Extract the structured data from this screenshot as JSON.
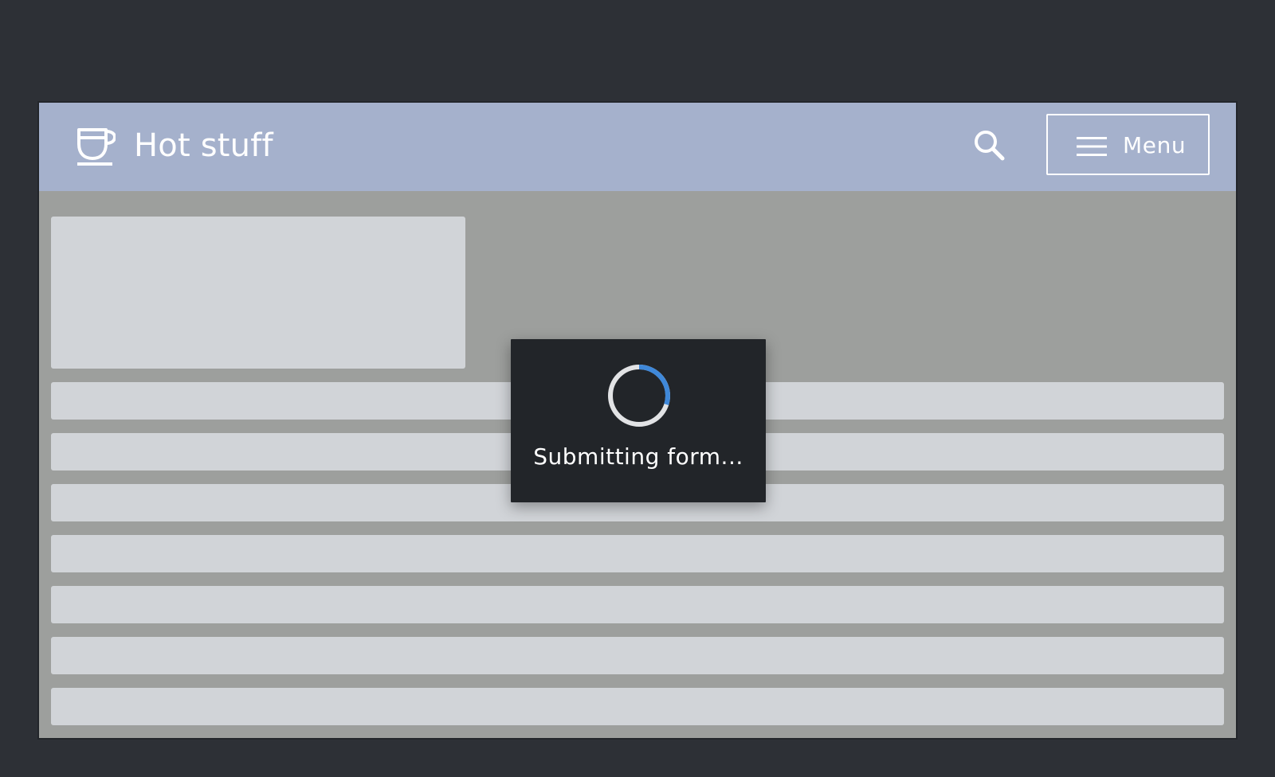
{
  "header": {
    "brand_title": "Hot stuff",
    "logo_icon": "coffee-cup-icon",
    "search_icon": "search-icon",
    "menu_icon": "hamburger-icon",
    "menu_label": "Menu"
  },
  "loading_dialog": {
    "message": "Submitting form...",
    "spinner_icon": "spinner-icon"
  },
  "colors": {
    "page_background": "#2d3036",
    "header_background": "#a5b1cc",
    "content_overlay": "#9d9f9d",
    "skeleton": "#d1d4d8",
    "dialog_background": "#222529",
    "spinner_track": "#e2e3e5",
    "spinner_accent": "#3f88d9"
  }
}
